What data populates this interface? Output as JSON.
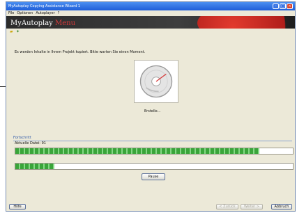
{
  "window": {
    "title": "MyAutoplay Copying Assistance Wizard 1"
  },
  "menubar": {
    "items": [
      "File",
      "Optionen",
      "Autoplayer",
      "?"
    ]
  },
  "banner": {
    "logo_prefix": "My",
    "logo_main": "Autoplay",
    "logo_suffix": "Menu"
  },
  "main": {
    "instruction": "Es werden Inhalte in Ihrem Projekt kopiert. Bitte warten Sie einen Moment.",
    "status": "Erstelle..."
  },
  "progress": {
    "section_title": "Fortschritt",
    "track_label": "Aktuelle Datei: 91",
    "bar1_fraction": 0.88,
    "bar2_fraction": 0.14,
    "pause_label": "Pause"
  },
  "footer": {
    "help_label": "Hilfe",
    "back_label": "< Zurück",
    "next_label": "Weiter >",
    "cancel_label": "Abbruch"
  },
  "colors": {
    "accent": "#d63a3a",
    "progress_green": "#3aa53a"
  },
  "icons": [
    "tb-folder-icon",
    "tb-star-icon",
    "disc-icon",
    "minimize-icon",
    "maximize-icon",
    "close-icon"
  ]
}
